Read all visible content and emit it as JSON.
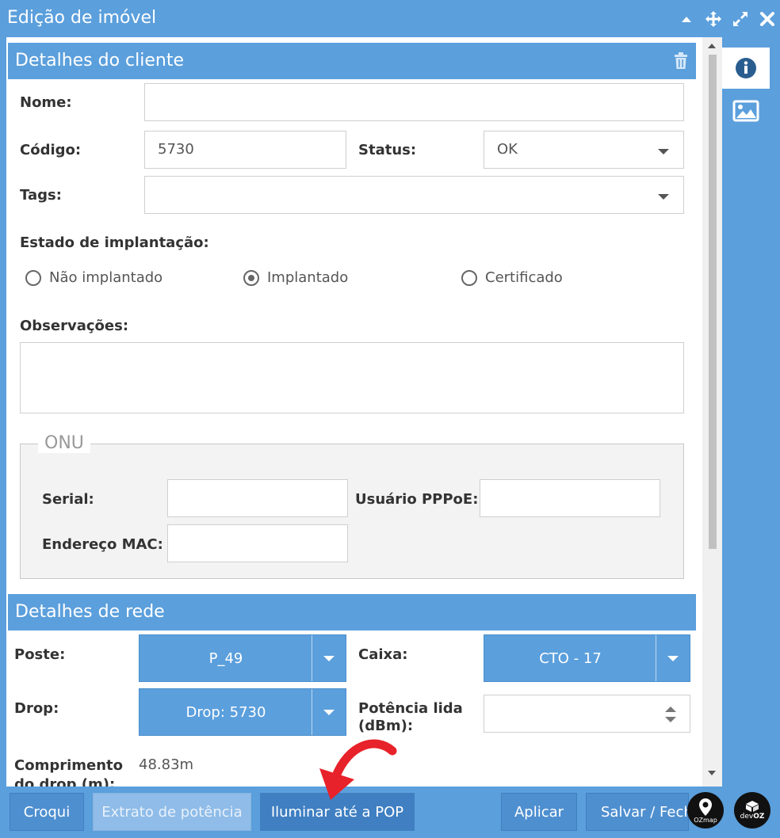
{
  "window": {
    "title": "Edição de imóvel"
  },
  "client": {
    "header": "Detalhes do cliente",
    "name_label": "Nome:",
    "name_value": "",
    "code_label": "Código:",
    "code_value": "5730",
    "status_label": "Status:",
    "status_value": "OK",
    "tags_label": "Tags:",
    "tags_value": "",
    "deploy_label": "Estado de implantação:",
    "deploy_options": [
      "Não implantado",
      "Implantado",
      "Certificado"
    ],
    "deploy_selected": "Implantado",
    "notes_label": "Observações:",
    "notes_value": ""
  },
  "onu": {
    "legend": "ONU",
    "serial_label": "Serial:",
    "serial_value": "",
    "pppoe_label": "Usuário PPPoE:",
    "pppoe_value": "",
    "mac_label": "Endereço MAC:",
    "mac_value": ""
  },
  "network": {
    "header": "Detalhes de rede",
    "pole_label": "Poste:",
    "pole_value": "P_49",
    "box_label": "Caixa:",
    "box_value": "CTO - 17",
    "drop_label": "Drop:",
    "drop_value": "Drop: 5730",
    "power_label": "Potência lida (dBm):",
    "power_value": "",
    "length_label": "Comprimento do drop (m):",
    "length_value": "48.83m"
  },
  "footer": {
    "croqui": "Croqui",
    "extract": "Extrato de potência",
    "illuminate": "Iluminar até a POP",
    "apply": "Aplicar",
    "save_close": "Salvar / Fechar"
  },
  "logos": {
    "ozmap": "OZmap",
    "devoz_top": "dev",
    "devoz_bottom": "OZ"
  },
  "colors": {
    "accent": "#5b9fdc",
    "button": "#4e8fd0",
    "disabled": "#8fbce8",
    "arrow": "#e8222a"
  }
}
